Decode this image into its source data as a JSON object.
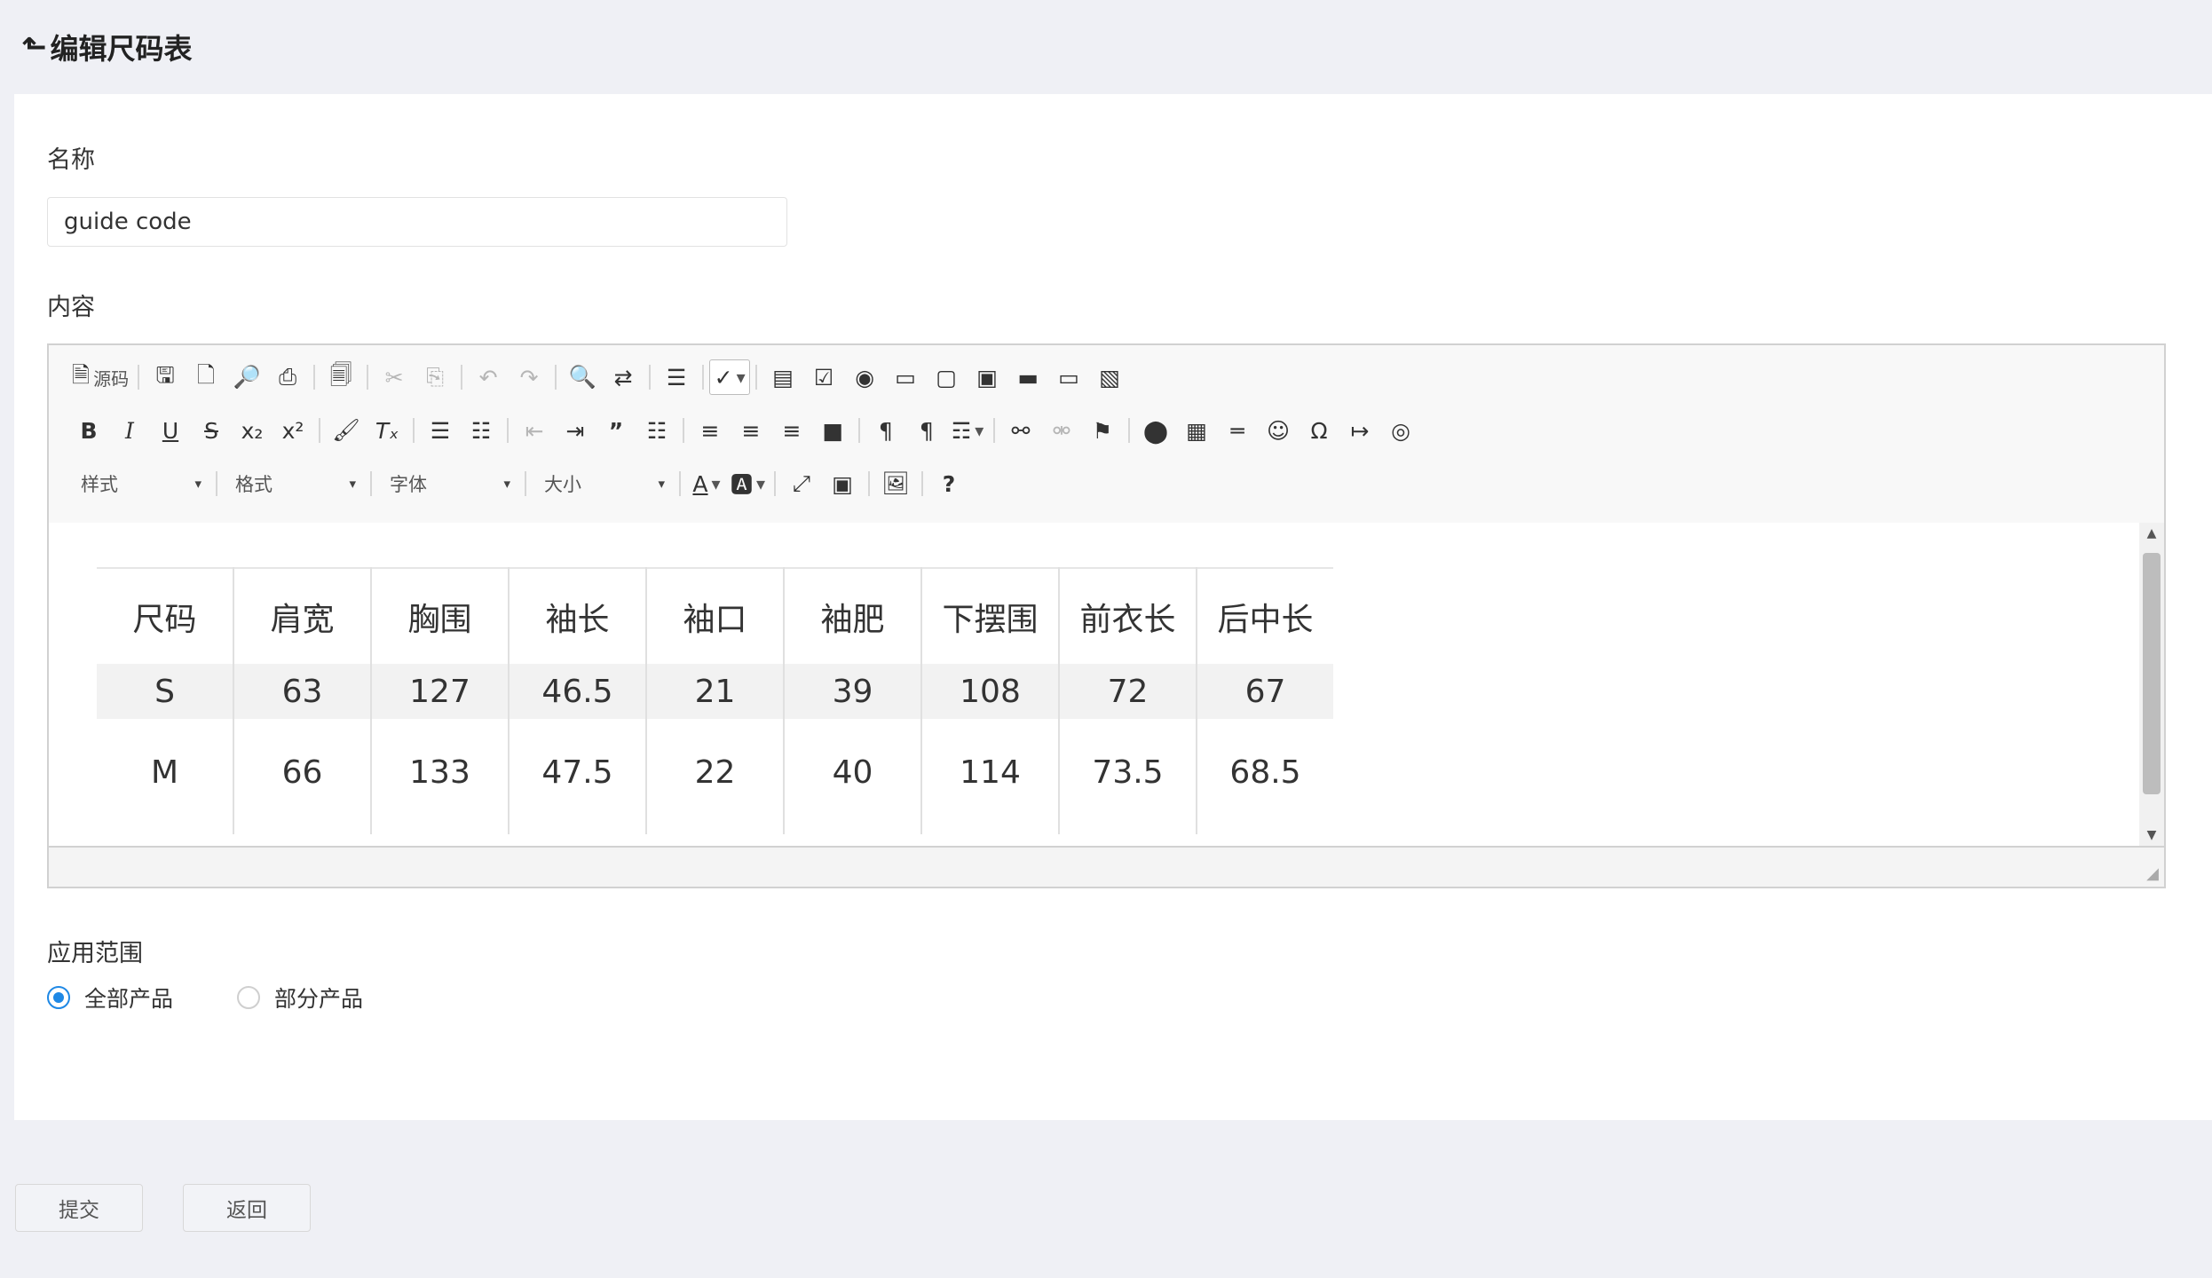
{
  "header": {
    "back_icon": "back-arrow-icon",
    "title": "编辑尺码表"
  },
  "form": {
    "name_label": "名称",
    "name_value": "guide code",
    "content_label": "内容",
    "scope_label": "应用范围",
    "scope_options": [
      {
        "label": "全部产品",
        "checked": true
      },
      {
        "label": "部分产品",
        "checked": false
      }
    ]
  },
  "editor": {
    "toolbar": {
      "source_label": "源码",
      "style_combo": "样式",
      "format_combo": "格式",
      "font_combo": "字体",
      "size_combo": "大小",
      "help_label": "?"
    },
    "table": {
      "headers": [
        "尺码",
        "肩宽",
        "胸围",
        "袖长",
        "袖口",
        "袖肥",
        "下摆围",
        "前衣长",
        "后中长"
      ],
      "rows": [
        [
          "S",
          "63",
          "127",
          "46.5",
          "21",
          "39",
          "108",
          "72",
          "67"
        ],
        [
          "M",
          "66",
          "133",
          "47.5",
          "22",
          "40",
          "114",
          "73.5",
          "68.5"
        ]
      ]
    }
  },
  "actions": {
    "submit_label": "提交",
    "back_label": "返回"
  },
  "colors": {
    "accent": "#1e88e5",
    "page_bg": "#eff0f5"
  }
}
